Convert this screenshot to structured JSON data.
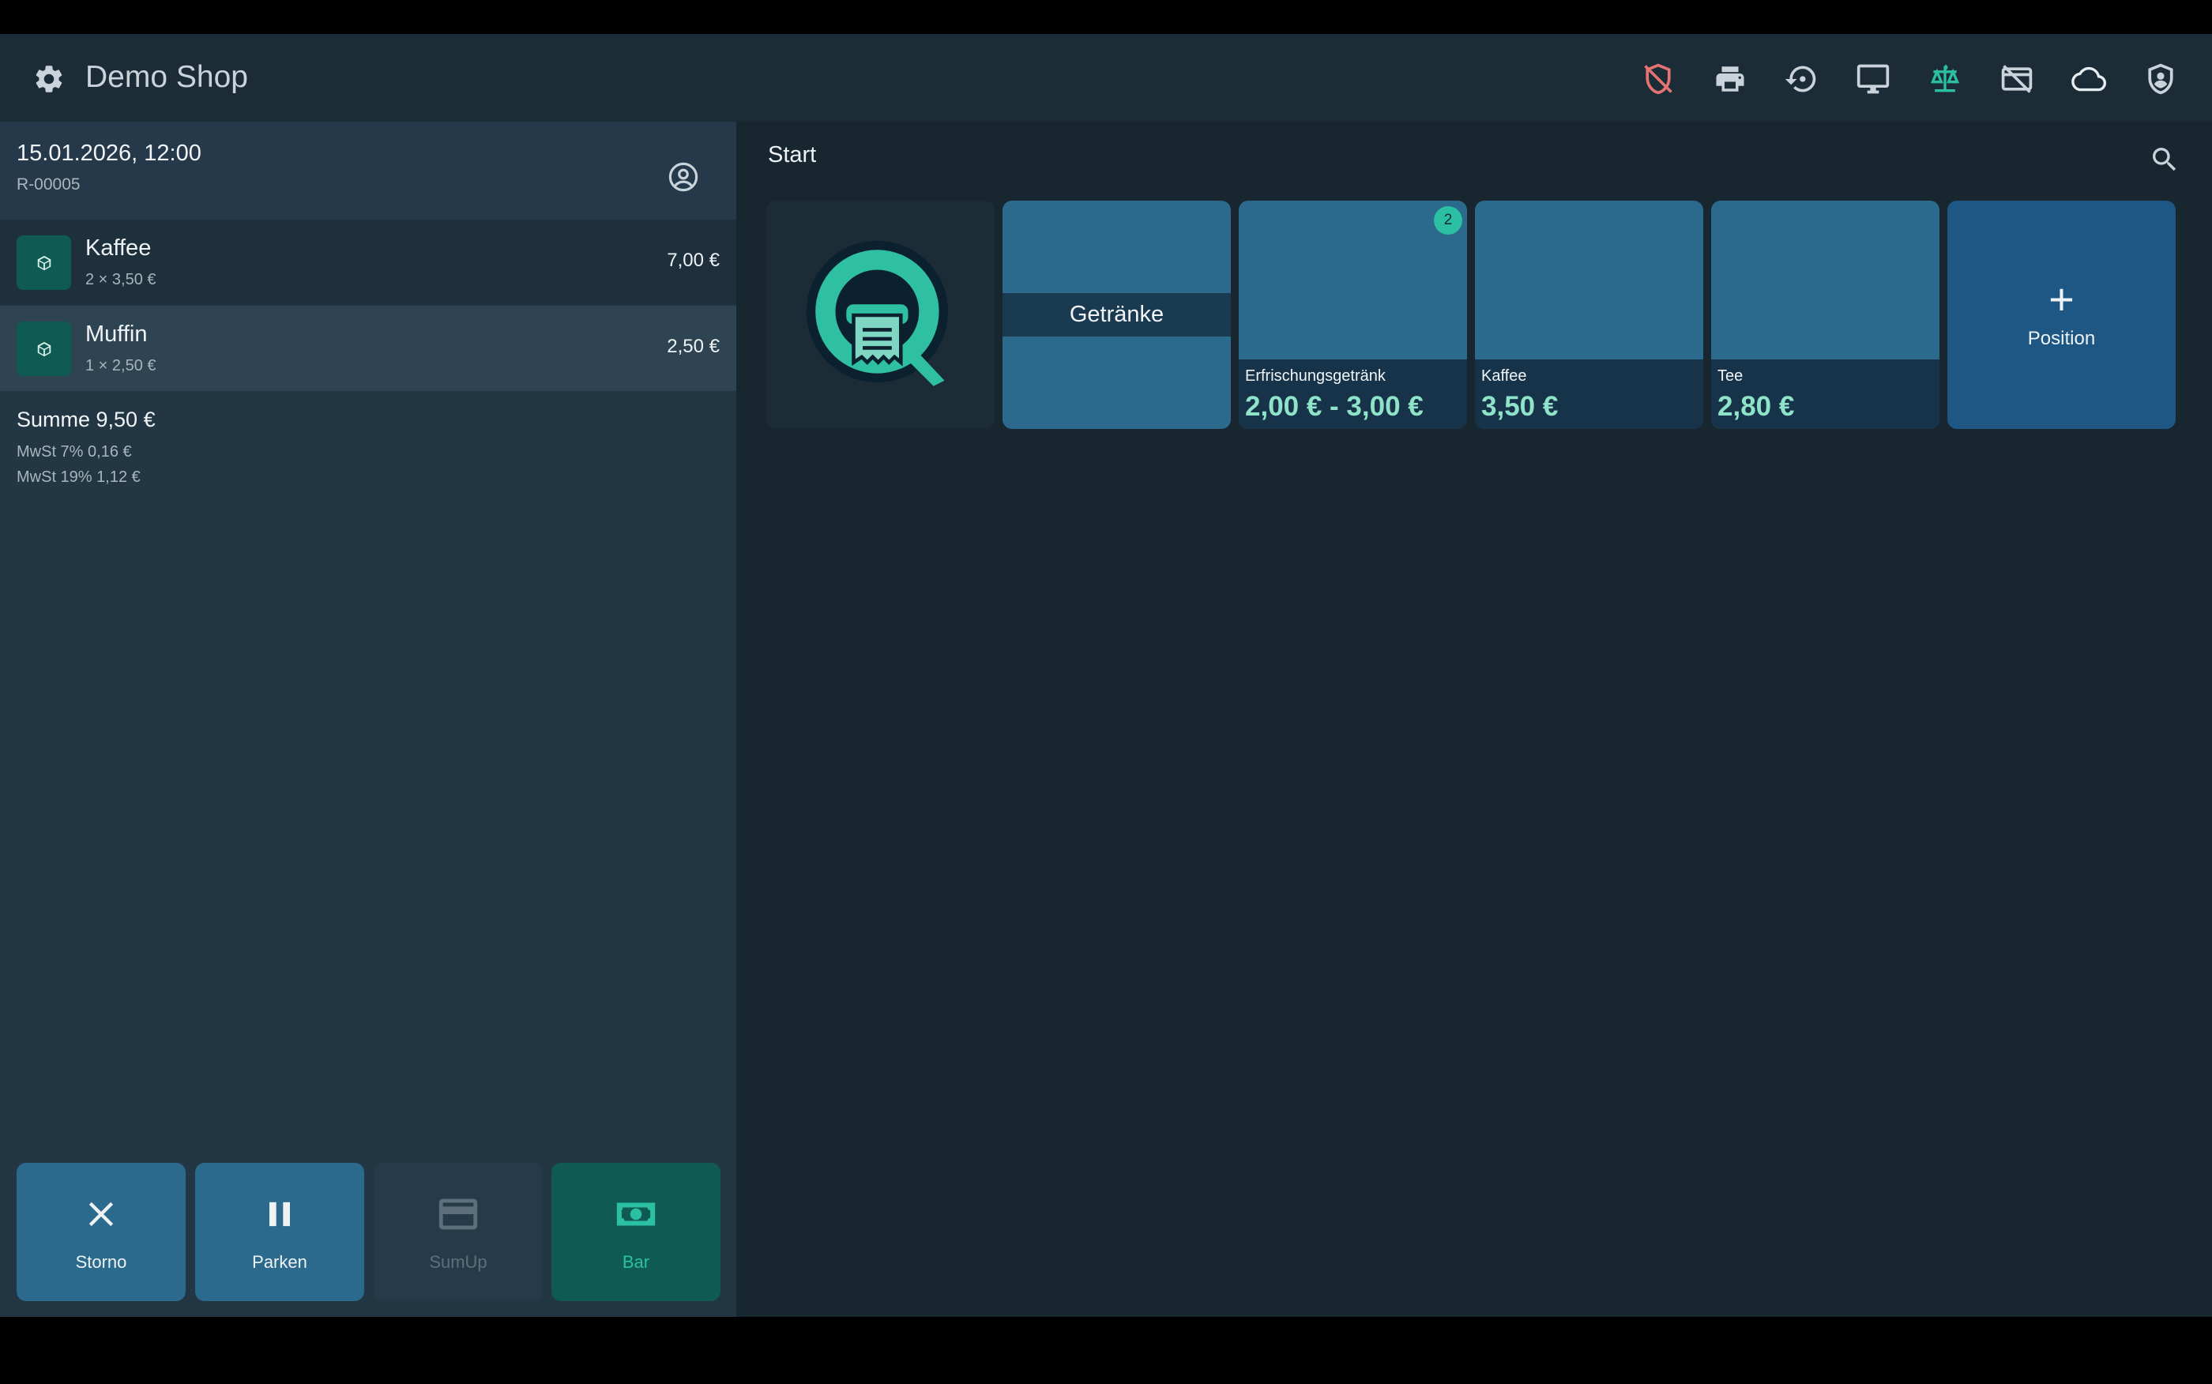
{
  "colors": {
    "accent": "#2bbfa4",
    "warning_icon": "#e57373",
    "active_icon": "#2bbfa4",
    "price_text": "#8fe3c8",
    "storno_bg": "#2b6a8c",
    "parken_bg": "#2b6a8c",
    "sumup_bg": "#263b49",
    "bar_bg": "#0f5b54"
  },
  "topbar": {
    "settings_icon": "gear-icon",
    "shop_name": "Demo Shop",
    "tools": [
      {
        "name": "shield-off-icon"
      },
      {
        "name": "printer-icon"
      },
      {
        "name": "history-icon"
      },
      {
        "name": "monitor-icon"
      },
      {
        "name": "scale-icon"
      },
      {
        "name": "card-off-icon"
      },
      {
        "name": "cloud-icon"
      },
      {
        "name": "shield-account-icon"
      }
    ]
  },
  "receipt": {
    "datetime": "15.01.2026, 12:00",
    "number": "R-00005",
    "customer_icon": "account-circle-icon",
    "lines": [
      {
        "name": "Kaffee",
        "qty": "2 × 3,50 €",
        "total": "7,00 €"
      },
      {
        "name": "Muffin",
        "qty": "1 × 2,50 €",
        "total": "2,50 €"
      }
    ],
    "sum": "Summe 9,50 €",
    "taxes": [
      "MwSt 7% 0,16 €",
      "MwSt 19% 1,12 €"
    ]
  },
  "actions": [
    {
      "label": "Storno",
      "icon": "close-icon"
    },
    {
      "label": "Parken",
      "icon": "pause-icon"
    },
    {
      "label": "SumUp",
      "icon": "credit-card-icon"
    },
    {
      "label": "Bar",
      "icon": "cash-icon"
    }
  ],
  "main": {
    "breadcrumb": "Start",
    "search_icon": "search-icon",
    "category": {
      "label": "Getränke"
    },
    "products": [
      {
        "name": "Erfrischungsgetränk",
        "price": "2,00 € - 3,00 €",
        "badge": "2"
      },
      {
        "name": "Kaffee",
        "price": "3,50 €"
      },
      {
        "name": "Tee",
        "price": "2,80 €"
      }
    ],
    "add_tile": {
      "label": "Position",
      "icon": "plus-icon"
    }
  }
}
